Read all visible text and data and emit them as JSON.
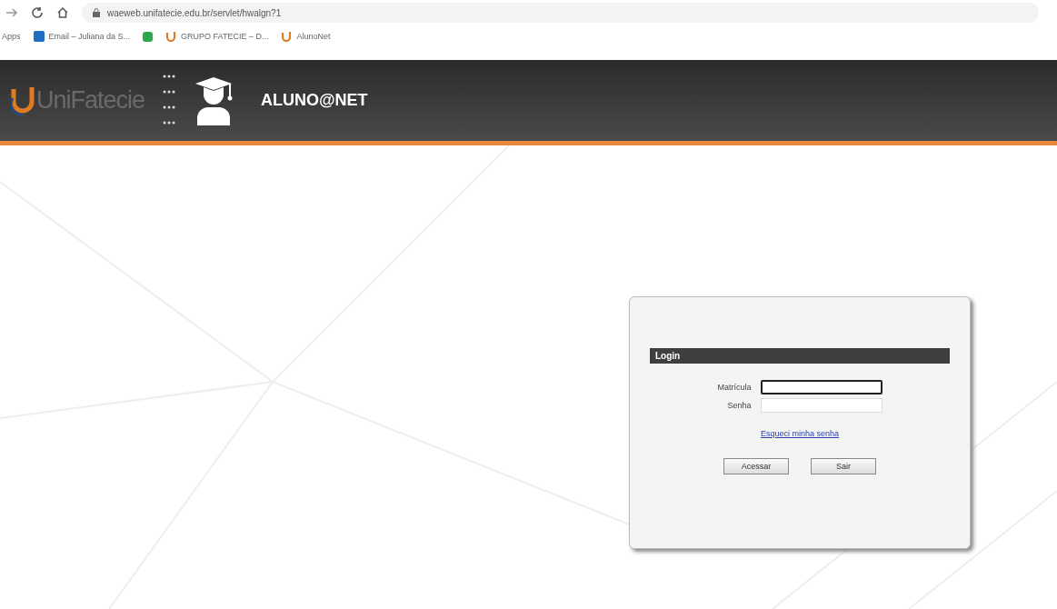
{
  "browser": {
    "url": "waeweb.unifatecie.edu.br/servlet/hwalgn?1",
    "bookmarks": [
      {
        "label": "Apps",
        "kind": "apps"
      },
      {
        "label": "Email – Juliana da S...",
        "kind": "mail"
      },
      {
        "kind": "green"
      },
      {
        "label": "GRUPO FATECIE – D...",
        "kind": "u"
      },
      {
        "label": "AlunoNet",
        "kind": "u"
      }
    ]
  },
  "header": {
    "logo": "UniFatecie",
    "title": "ALUNO@NET"
  },
  "login": {
    "title": "Login",
    "fields": [
      {
        "label": "Matrícula",
        "focused": true
      },
      {
        "label": "Senha",
        "focused": false
      }
    ],
    "link": "Esqueci minha senha",
    "buttons": [
      "Acessar",
      "Sair"
    ]
  }
}
